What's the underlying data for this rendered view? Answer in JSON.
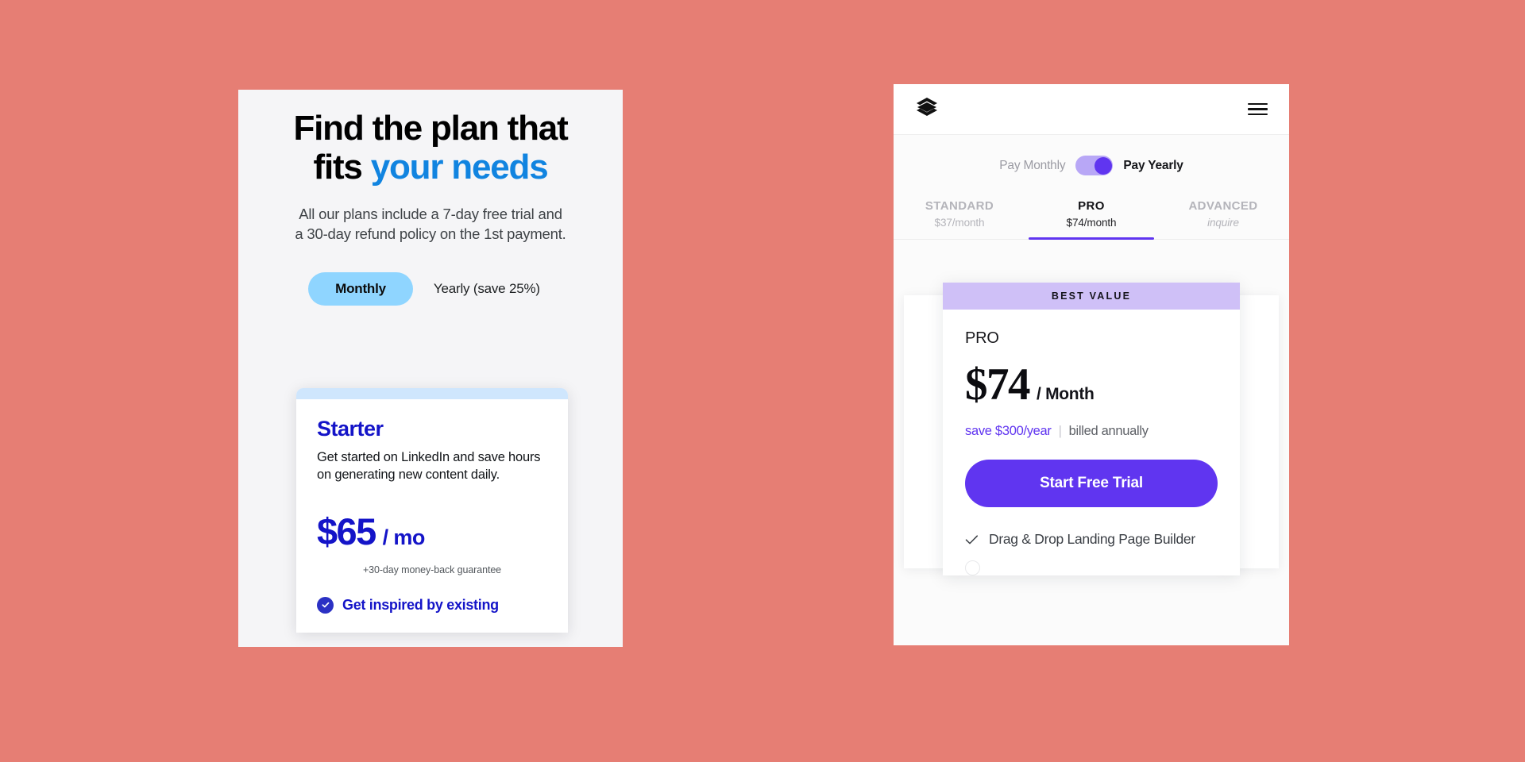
{
  "background_color": "#e67e74",
  "left_panel": {
    "heading_part1": "Find the plan that",
    "heading_part2": "fits ",
    "heading_accent": "your needs",
    "subtitle_line1": "All our plans include a 7-day free trial and",
    "subtitle_line2": "a 30-day refund policy on the 1st payment.",
    "billing_toggle": {
      "active_label": "Monthly",
      "inactive_label": "Yearly (save 25%)",
      "active_color": "#8fd5ff"
    },
    "card": {
      "plan_name": "Starter",
      "description": "Get started on LinkedIn and save hours on generating new content daily.",
      "price": "$65",
      "period": "/ mo",
      "guarantee": "+30-day money-back guarantee",
      "feature": "Get inspired by existing",
      "accent_color": "#1414c8",
      "band_color": "#cfe6fd"
    }
  },
  "right_panel": {
    "topbar": {
      "logo_icon": "layers-icon",
      "menu_icon": "hamburger-menu-icon"
    },
    "pay_toggle": {
      "left_label": "Pay Monthly",
      "right_label": "Pay Yearly",
      "state": "yearly",
      "accent_color": "#6035f0"
    },
    "tabs": [
      {
        "name": "STANDARD",
        "price": "$37/month",
        "active": false,
        "italic": false
      },
      {
        "name": "PRO",
        "price": "$74/month",
        "active": true,
        "italic": false
      },
      {
        "name": "ADVANCED",
        "price": "inquire",
        "active": false,
        "italic": true
      }
    ],
    "card": {
      "badge": "BEST VALUE",
      "badge_color": "#cfc0f7",
      "plan_name": "PRO",
      "price": "$74",
      "period": "/ Month",
      "save_note": "save $300/year",
      "divider": "|",
      "billed_note": "billed annually",
      "cta_label": "Start Free Trial",
      "cta_color": "#6035f0",
      "feature": "Drag & Drop Landing Page Builder"
    }
  }
}
